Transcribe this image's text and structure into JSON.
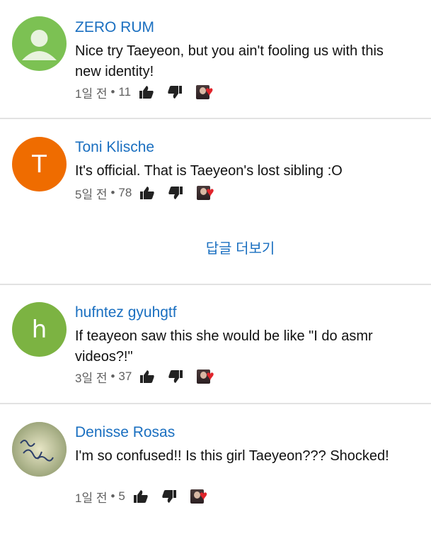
{
  "comments": [
    {
      "author": "ZERO RUM",
      "avatar_kind": "default-person",
      "avatar_color": "#7cc153",
      "text": "Nice try Taeyeon, but you ain't fooling us with this new identity!",
      "time": "1일 전",
      "likes": "11"
    },
    {
      "author": "Toni Klische",
      "avatar_kind": "letter",
      "avatar_letter": "T",
      "avatar_color": "#ef6c00",
      "text": "It's official. That is Taeyeon's lost sibling :O",
      "time": "5일 전",
      "likes": "78"
    },
    {
      "author": "hufntez gyuhgtf",
      "avatar_kind": "letter",
      "avatar_letter": "h",
      "avatar_color": "#7cb342",
      "text": "If teayeon saw this she would be like \"I do asmr videos?!\"",
      "time": "3일 전",
      "likes": "37"
    },
    {
      "author": "Denisse Rosas",
      "avatar_kind": "photo",
      "avatar_color": "#c9c79a",
      "text": "I'm so confused!! Is this girl Taeyeon??? Shocked!",
      "time": "1일 전",
      "likes": "5"
    }
  ],
  "more_replies_label": "답글 더보기",
  "separator": "•",
  "colors": {
    "link": "#1a6fc0",
    "meta": "#606060",
    "heart": "#e0242b",
    "divider": "#e2e2e2"
  }
}
